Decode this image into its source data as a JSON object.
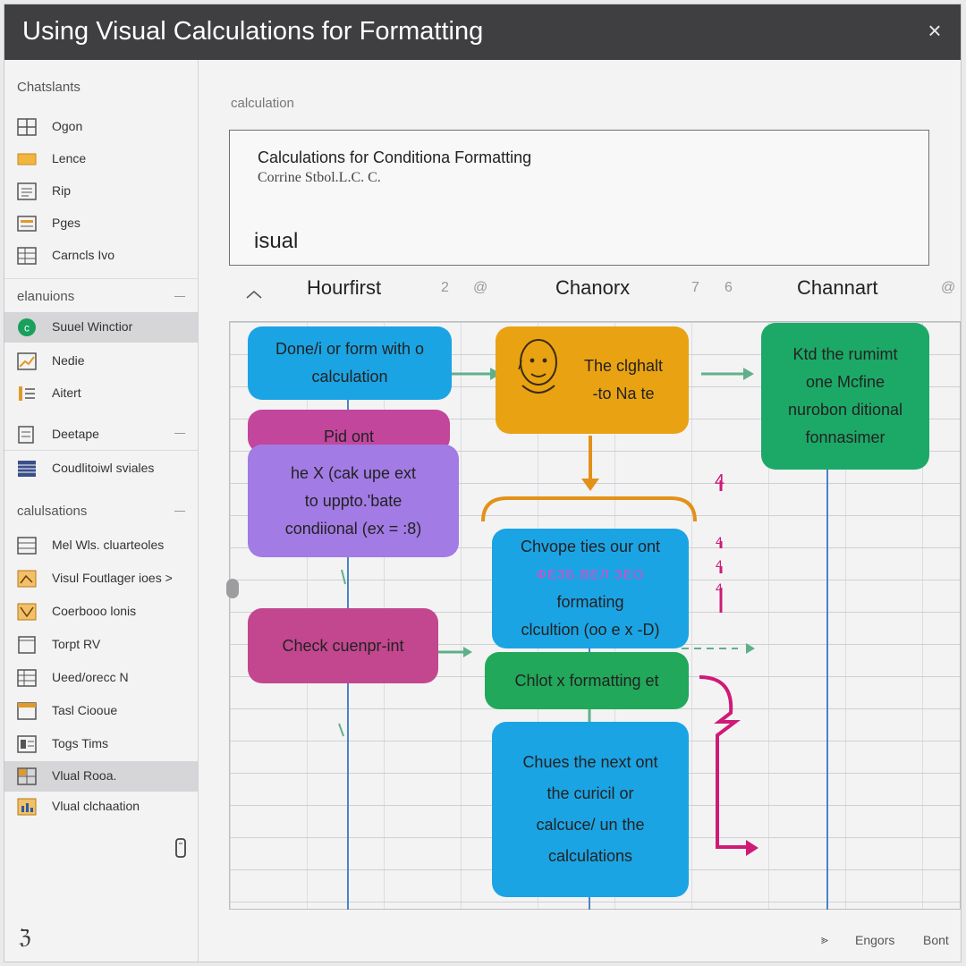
{
  "window": {
    "title": "Using Visual Calculations for Formatting",
    "close_symbol": "×"
  },
  "sidebar": {
    "sections": [
      {
        "label": "Chatslants"
      },
      {
        "label": "elanuions"
      },
      {
        "label": "calulsations"
      }
    ],
    "items": [
      {
        "label": "Ogon",
        "icon": "grid-icon"
      },
      {
        "label": "Lence",
        "icon": "folder-icon"
      },
      {
        "label": "Rip",
        "icon": "list-icon"
      },
      {
        "label": "Pges",
        "icon": "pages-icon"
      },
      {
        "label": "Carncls Ivo",
        "icon": "table-icon"
      },
      {
        "label": "Suuel Winctior",
        "icon": "circle-c-icon"
      },
      {
        "label": "Nedie",
        "icon": "chart-icon"
      },
      {
        "label": "Aitert",
        "icon": "list-bars-icon"
      },
      {
        "label": "Deetape",
        "icon": "document-icon"
      },
      {
        "label": "Coudlitoiwl sviales",
        "icon": "stripes-icon"
      },
      {
        "label": "Mel Wls. cluarteoles",
        "icon": "table-icon"
      },
      {
        "label": "Visul Foutlager ioes >",
        "icon": "orange-chart-icon"
      },
      {
        "label": "Coerbooo lonis",
        "icon": "orange-chart-icon"
      },
      {
        "label": "Torpt RV",
        "icon": "frame-icon"
      },
      {
        "label": "Ueed/orecc N",
        "icon": "table-icon"
      },
      {
        "label": "Tasl Ciooue",
        "icon": "window-icon"
      },
      {
        "label": "Togs Tims",
        "icon": "layout-icon"
      },
      {
        "label": "Vlual Rooa.",
        "icon": "grid-icon"
      },
      {
        "label": "Vlual clchaation",
        "icon": "orange-chart-icon"
      }
    ],
    "footer_icon": "phone-icon",
    "footer_mark": "ℨ"
  },
  "main": {
    "breadcrumb": "calculation",
    "panel": {
      "heading": "Calculations for Conditiona Formatting",
      "subheading": "Corrine Stbol.L.C. C.",
      "value": "isual"
    },
    "columns": [
      {
        "title": "Hourfirst",
        "num1": "2",
        "num2": "@"
      },
      {
        "title": "Chanorx",
        "num1": "7",
        "num2": "6"
      },
      {
        "title": "Channart",
        "num1": "@"
      }
    ],
    "flow_boxes": [
      {
        "name": "done-for-form-box",
        "lines": [
          "Done/i or form with o",
          "calculation"
        ],
        "color": "#1ba4e4"
      },
      {
        "name": "pid-ont-box",
        "lines": [
          "Pid ont"
        ],
        "color": "#c2469c"
      },
      {
        "name": "upper-conditional-box",
        "lines": [
          "he  X (cak upe ext",
          "to uppto.'bate",
          "condiional (ex = :8)"
        ],
        "color": "#a27be4"
      },
      {
        "name": "check-queenprint-box",
        "lines": [
          "Check cuenpr-int"
        ],
        "color": "#c2478f"
      },
      {
        "name": "clephant-box",
        "lines": [
          "The clghalt",
          "-to Na te"
        ],
        "color": "#e9a212"
      },
      {
        "name": "chovope-box",
        "lines": [
          "Chvope ties our ont",
          "ФЕЗБ.ВЕЛ ЗЕО",
          "formating",
          "clcultion (oo e x -D)"
        ],
        "color": "#1ba4e4"
      },
      {
        "name": "check-formatting-box",
        "lines": [
          "Chlot x formatting et"
        ],
        "color": "#21a85a"
      },
      {
        "name": "chues-next-box",
        "lines": [
          "Chues the next ont",
          "the curicil or",
          "calcuce/ un the",
          "calculations"
        ],
        "color": "#1ba4e4"
      },
      {
        "name": "mcfine-box",
        "lines": [
          "Ktd the rumimt",
          "one Mcfine",
          "nurobon ditional",
          "fonnasimer"
        ],
        "color": "#1ca967"
      }
    ],
    "margin_marks": [
      "4",
      "4",
      "4",
      "4"
    ]
  },
  "footer": {
    "link1": "Engors",
    "link2": "Bont",
    "arrow": "⪢"
  },
  "colors": {
    "titlebar": "#3f3f42",
    "blue": "#1ba4e4",
    "orange": "#e9a212",
    "green": "#1ca967",
    "pink": "#c2469c",
    "purple": "#a27be4",
    "magenta": "#cf1a77"
  }
}
